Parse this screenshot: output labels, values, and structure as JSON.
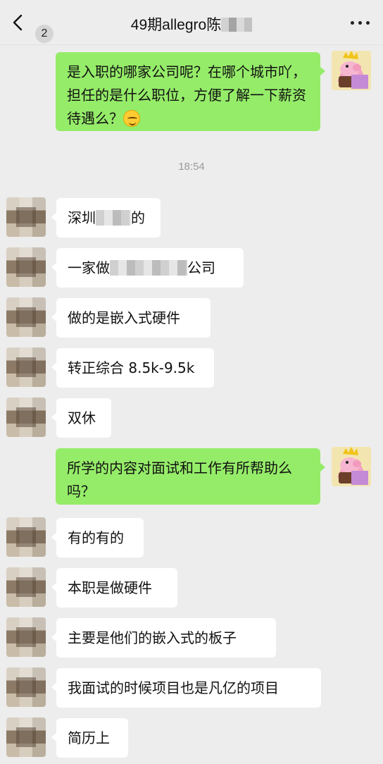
{
  "header": {
    "unread_count": "2",
    "title": "49期allegro陈"
  },
  "timestamp": "18:54",
  "messages": [
    {
      "side": "right",
      "text": "是入职的哪家公司呢？在哪个城市吖，担任的是什么职位，方便了解一下薪资待遇么？"
    },
    {
      "side": "left",
      "text_a": "深圳",
      "text_b": "的"
    },
    {
      "side": "left",
      "text_a": "一家做",
      "text_b": "公司"
    },
    {
      "side": "left",
      "text": "做的是嵌入式硬件"
    },
    {
      "side": "left",
      "text": "转正综合 8.5k-9.5k"
    },
    {
      "side": "left",
      "text": "双休"
    },
    {
      "side": "right",
      "text": "所学的内容对面试和工作有所帮助么吗？"
    },
    {
      "side": "left",
      "text": "有的有的"
    },
    {
      "side": "left",
      "text": "本职是做硬件"
    },
    {
      "side": "left",
      "text": "主要是他们的嵌入式的板子"
    },
    {
      "side": "left",
      "text": "我面试的时候项目也是凡亿的项目"
    },
    {
      "side": "left",
      "text": "简历上"
    }
  ]
}
